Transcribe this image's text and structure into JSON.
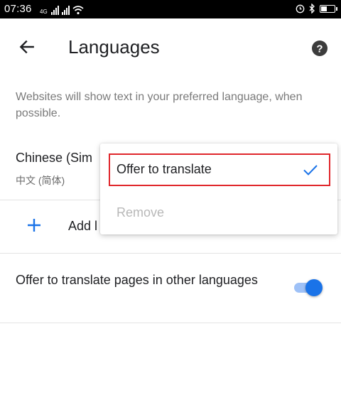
{
  "status_bar": {
    "time": "07:36",
    "signal_label": "4G",
    "battery_level": 0.45
  },
  "toolbar": {
    "title": "Languages",
    "back_icon": "arrow-left-icon",
    "help_icon": "help-circle-icon"
  },
  "description": "Websites will show text in your preferred language, when possible.",
  "language_item": {
    "name": "Chinese (Sim",
    "native_name": "中文 (简体)"
  },
  "add_language": {
    "label": "Add l",
    "icon": "plus-icon"
  },
  "translate_setting": {
    "label": "Offer to translate pages in other languages",
    "enabled": true
  },
  "context_menu": {
    "items": [
      {
        "label": "Offer to translate",
        "checked": true
      },
      {
        "label": "Remove",
        "enabled": false
      }
    ]
  },
  "colors": {
    "accent": "#1a73e8",
    "highlight_border": "#e0262b",
    "disabled_text": "#b8b8b8"
  }
}
